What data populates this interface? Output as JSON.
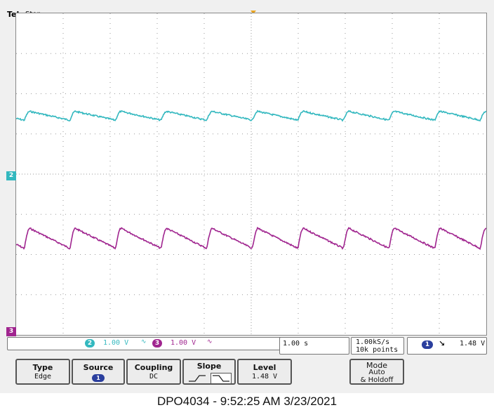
{
  "header": {
    "brand": "Tek",
    "status": "Stop"
  },
  "colors": {
    "ch2": "#33b8bf",
    "ch3": "#a0258f",
    "ch1": "#2b3f9e",
    "trigger": "#e8a320",
    "grid": "#9a9a9a"
  },
  "channels": [
    {
      "id": "2",
      "scale": "1.00 V",
      "bandwidth_icon": "bandwidth-limit-icon"
    },
    {
      "id": "3",
      "scale": "1.00 V",
      "bandwidth_icon": "bandwidth-limit-icon"
    }
  ],
  "readouts": {
    "timebase": "1.00 s",
    "sample_rate": "1.00kS/s",
    "record_length": "10k points",
    "trigger_source": "1",
    "trigger_level": "1.48 V"
  },
  "softkeys": [
    {
      "title": "Type",
      "value": "Edge"
    },
    {
      "title": "Source",
      "value": "1"
    },
    {
      "title": "Coupling",
      "value": "DC"
    },
    {
      "title": "Slope",
      "value": ""
    },
    {
      "title": "Level",
      "value": "1.48 V"
    },
    {
      "title": "Mode",
      "value": "Auto",
      "value2": "& Holdoff"
    }
  ],
  "caption": "DPO4034 - 9:52:25 AM   3/23/2021",
  "waveforms": {
    "period_s": 0.97,
    "ch2": {
      "level_div": 1.45,
      "ripple_div": 0.22
    },
    "ch3": {
      "level_div": -1.6,
      "ripple_div": 0.5
    }
  }
}
